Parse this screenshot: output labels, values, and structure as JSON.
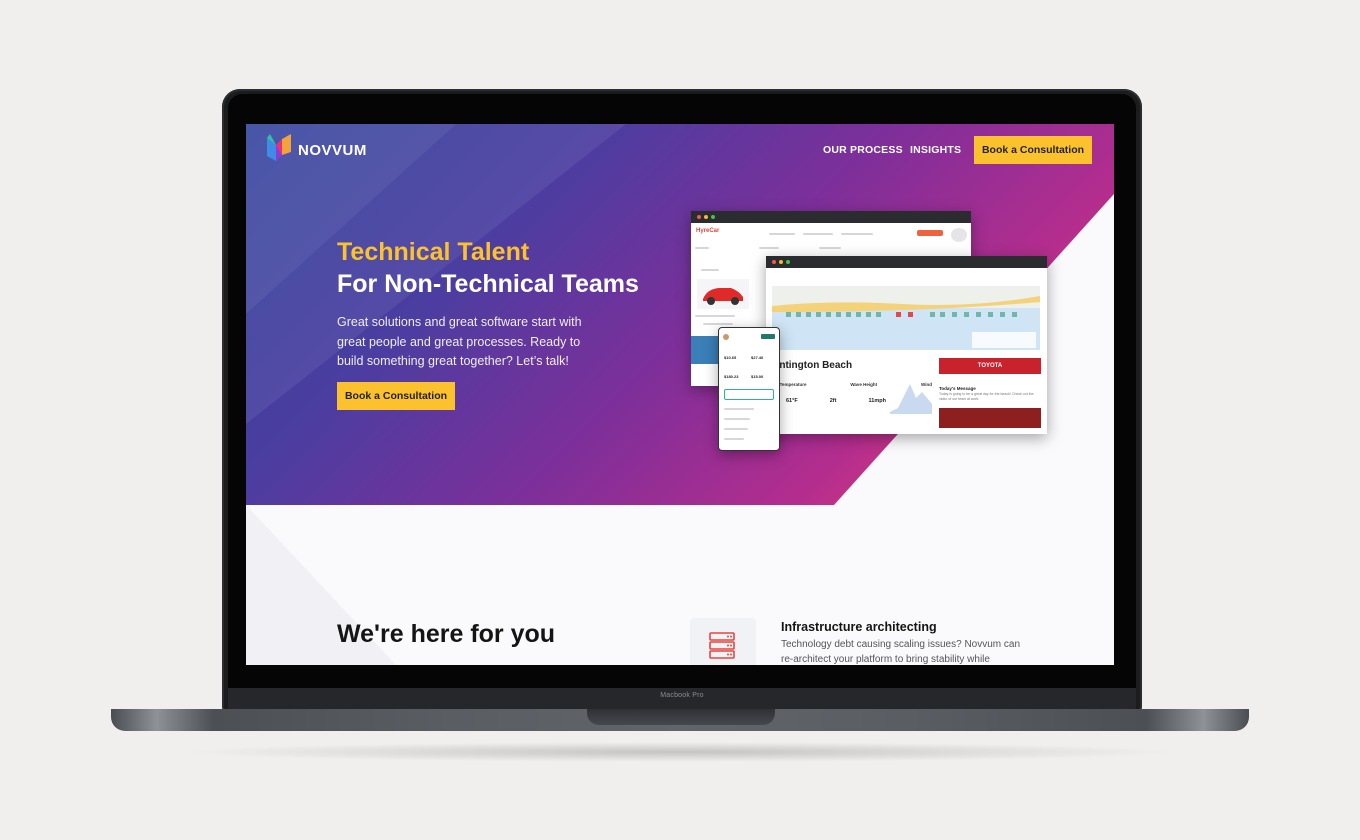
{
  "device": {
    "label": "Macbook Pro"
  },
  "nav": {
    "brand": "NOVVUM",
    "links": [
      "OUR PROCESS",
      "INSIGHTS"
    ],
    "cta": "Book a Consultation"
  },
  "hero": {
    "title_line1": "Technical Talent",
    "title_line2": "For Non-Technical Teams",
    "subtitle": "Great solutions and great software start with great people and great processes.  Ready to build something great together?  Let’s talk!",
    "cta": "Book a Consultation"
  },
  "mockup": {
    "app_name": "HyreCar",
    "location": "Huntington Beach",
    "weather": {
      "labels": [
        "Water Temperature",
        "Wave Height",
        "Wind"
      ],
      "values": [
        "61°F",
        "2ft",
        "11mph"
      ]
    },
    "message_title": "Today's Message",
    "message_text": "Today is going to be a great day for the beach! Check out the video of our team at work.",
    "ad_brand": "TOYOTA",
    "phone_values": [
      "$10.65",
      "$27.40",
      "$180.23",
      "$15.00"
    ]
  },
  "section2": {
    "title": "We're here for you",
    "service_title": "Infrastructure architecting",
    "service_text": "Technology debt causing scaling issues? Novvum can re-architect your platform to bring stability while"
  },
  "colors": {
    "accent": "#fbc22e",
    "hero_start": "#2e3f9b",
    "hero_end": "#f46048"
  },
  "icons": [
    "novvum-logo-icon",
    "server-stack-icon"
  ]
}
